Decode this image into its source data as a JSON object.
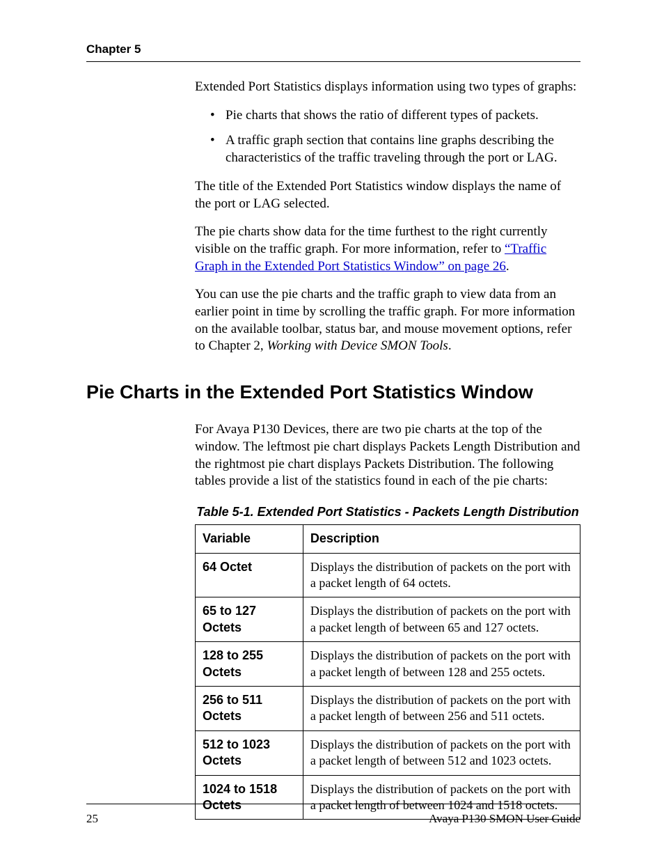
{
  "header": {
    "chapter": "Chapter 5"
  },
  "intro": {
    "lead": "Extended Port Statistics displays information using two types of graphs:",
    "bullets": [
      "Pie charts that shows the ratio of different types of packets.",
      "A traffic graph section that contains line graphs describing the characteristics of the traffic traveling through the port or LAG."
    ],
    "p2": "The title of the Extended Port Statistics window displays the name of the port or LAG selected.",
    "p3a": "The pie charts show data for the time furthest to the right currently visible on the traffic graph. For more information, refer to ",
    "p3link": "“Traffic Graph in the Extended Port Statistics Window” on page 26",
    "p3b": ".",
    "p4a": "You can use the pie charts and the traffic graph to view data from an earlier point in time by scrolling the traffic graph. For more information on the available toolbar, status bar, and mouse movement options, refer to Chapter 2, ",
    "p4i": "Working with Device SMON Tools",
    "p4b": "."
  },
  "section": {
    "heading": "Pie Charts in the Extended Port Statistics Window",
    "p1": "For Avaya P130 Devices, there are two pie charts at the top of the window. The leftmost pie chart displays Packets Length Distribution and the rightmost pie chart displays Packets Distribution. The following tables provide a list of the statistics found in each of the pie charts:"
  },
  "table": {
    "caption": "Table 5-1.  Extended Port Statistics - Packets Length Distribution",
    "head_var": "Variable",
    "head_desc": "Description",
    "rows": [
      {
        "var": "64 Octet",
        "desc": "Displays the distribution of packets on the port with a packet length of 64 octets."
      },
      {
        "var": "65 to 127 Octets",
        "desc": "Displays the distribution of packets on the port with a packet length of between 65 and 127 octets."
      },
      {
        "var": "128 to 255 Octets",
        "desc": "Displays the distribution of packets on the port with a packet length of between 128 and 255 octets."
      },
      {
        "var": "256 to 511 Octets",
        "desc": "Displays the distribution of packets on the port with a packet length of between 256 and 511 octets."
      },
      {
        "var": "512 to 1023 Octets",
        "desc": "Displays the distribution of packets on the port with a packet length of between 512 and 1023 octets."
      },
      {
        "var": "1024 to 1518 Octets",
        "desc": "Displays the distribution of packets on the port with a packet length of between 1024 and 1518 octets."
      }
    ]
  },
  "footer": {
    "page": "25",
    "doc": "Avaya P130 SMON User Guide"
  }
}
